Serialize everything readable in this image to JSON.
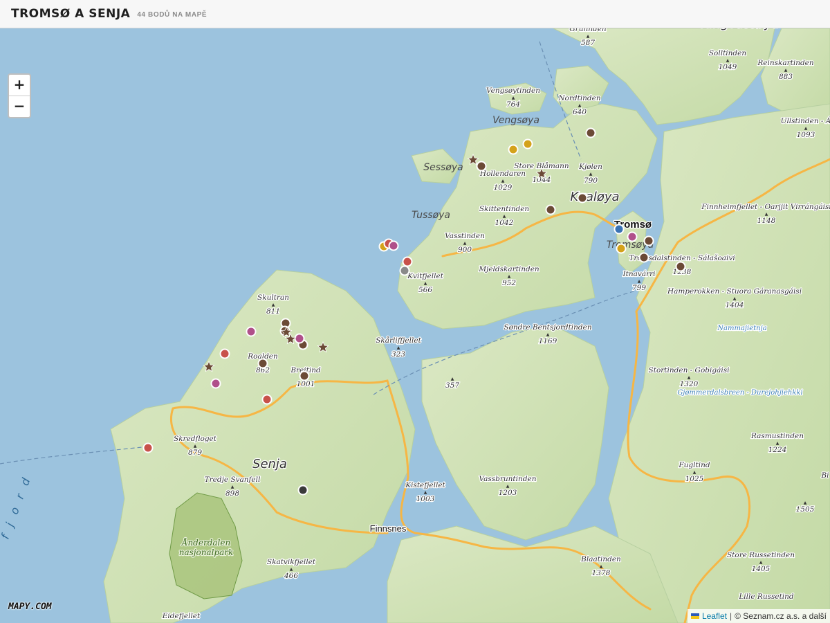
{
  "header": {
    "title": "TROMSØ A SENJA",
    "subtitle": "44 BODŮ NA MAPĚ"
  },
  "zoom": {
    "in": "+",
    "out": "−"
  },
  "logo": "MAPY.COM",
  "attribution": {
    "leaflet": "Leaflet",
    "separator": "|",
    "credits": "© Seznam.cz a.s. a další"
  },
  "colors": {
    "water": "#9cc3de",
    "land": "#cfe1b4",
    "road": "#f6b645",
    "park": "#b7cf8e"
  },
  "places": [
    {
      "name": "Grunnden",
      "elev": "587"
    },
    {
      "name": "Ringvassøya",
      "elev": ""
    },
    {
      "name": "Solltinden",
      "elev": "1049"
    },
    {
      "name": "Reinskartinden",
      "elev": "883"
    },
    {
      "name": "Vengsøytinden",
      "elev": "764"
    },
    {
      "name": "Nordtinden",
      "elev": "640"
    },
    {
      "name": "Vengsøya",
      "elev": ""
    },
    {
      "name": "Ullstinden - Á",
      "elev": "1093"
    },
    {
      "name": "Sessøya",
      "elev": ""
    },
    {
      "name": "Hollendaren",
      "elev": "1029"
    },
    {
      "name": "Store Blåmann",
      "elev": "1044"
    },
    {
      "name": "Kjølen",
      "elev": "790"
    },
    {
      "name": "Kvaløya",
      "elev": ""
    },
    {
      "name": "Tussøya",
      "elev": ""
    },
    {
      "name": "Skittentinden",
      "elev": "1042"
    },
    {
      "name": "Tromsø",
      "elev": ""
    },
    {
      "name": "Tromsøya",
      "elev": ""
    },
    {
      "name": "Finnheimfjellet - Oarjjit Virrángáisi",
      "elev": "1148"
    },
    {
      "name": "Vasstinden",
      "elev": "900"
    },
    {
      "name": "Tromsdalstinden - Sálašoaivi",
      "elev": "1238"
    },
    {
      "name": "Mjeldskartinden",
      "elev": "952"
    },
    {
      "name": "Kvitfjellet",
      "elev": "566"
    },
    {
      "name": "Itnavárri",
      "elev": "799"
    },
    {
      "name": "Hamperokken - Stuora Gáranasgáisi",
      "elev": "1404"
    },
    {
      "name": "Nammajietnja",
      "elev": ""
    },
    {
      "name": "Skultran",
      "elev": "811"
    },
    {
      "name": "Søndre Bentsjordtinden",
      "elev": "1169"
    },
    {
      "name": "Skårliffjellet",
      "elev": "323"
    },
    {
      "name": "Roalden",
      "elev": "862"
    },
    {
      "name": "Breitind",
      "elev": "1001"
    },
    {
      "name": "Stortinden - Gobigáisi",
      "elev": "1320"
    },
    {
      "name": "Gjømmerdalsbreen - Durejohjiehkki",
      "elev": ""
    },
    {
      "name": "",
      "elev": "357"
    },
    {
      "name": "Skredfloget",
      "elev": "879"
    },
    {
      "name": "Senja",
      "elev": ""
    },
    {
      "name": "Rasmustinden",
      "elev": "1224"
    },
    {
      "name": "Tredje Svanfell",
      "elev": "898"
    },
    {
      "name": "Fugltind",
      "elev": "1025"
    },
    {
      "name": "Kistefjellet",
      "elev": "1003"
    },
    {
      "name": "Vassbruntinden",
      "elev": "1203"
    },
    {
      "name": "Ånderdalen nasjonalpark",
      "elev": ""
    },
    {
      "name": "Finnsnes",
      "elev": ""
    },
    {
      "name": "Skatvikfjellet",
      "elev": "466"
    },
    {
      "name": "Blaatinden",
      "elev": "1378"
    },
    {
      "name": "Store Russetinden",
      "elev": "1405"
    },
    {
      "name": "Lille Russetind",
      "elev": ""
    },
    {
      "name": "Eidefjellet",
      "elev": ""
    },
    {
      "name": "",
      "elev": "1505"
    },
    {
      "name": "Bi",
      "elev": ""
    },
    {
      "name": "fjord",
      "elev": ""
    }
  ],
  "markers": [
    {
      "type": "dot",
      "color": "#6b4a36"
    },
    {
      "type": "dot",
      "color": "#6b4a36"
    },
    {
      "type": "dot",
      "color": "#6b4a36"
    },
    {
      "type": "dot",
      "color": "#6b4a36"
    },
    {
      "type": "dot",
      "color": "#6b4a36"
    },
    {
      "type": "dot",
      "color": "#6b4a36"
    },
    {
      "type": "dot",
      "color": "#6b4a36"
    },
    {
      "type": "dot",
      "color": "#6b4a36"
    },
    {
      "type": "dot",
      "color": "#6b4a36"
    },
    {
      "type": "dot",
      "color": "#6b4a36"
    },
    {
      "type": "dot",
      "color": "#6b4a36"
    },
    {
      "type": "dot",
      "color": "#6b4a36"
    },
    {
      "type": "dot",
      "color": "#d4a21a"
    },
    {
      "type": "dot",
      "color": "#d4a21a"
    },
    {
      "type": "dot",
      "color": "#d4a21a"
    },
    {
      "type": "dot",
      "color": "#d4a21a"
    },
    {
      "type": "dot",
      "color": "#c8524a"
    },
    {
      "type": "dot",
      "color": "#c8524a"
    },
    {
      "type": "dot",
      "color": "#c8524a"
    },
    {
      "type": "dot",
      "color": "#c8524a"
    },
    {
      "type": "dot",
      "color": "#c8524a"
    },
    {
      "type": "dot",
      "color": "#b0508a"
    },
    {
      "type": "dot",
      "color": "#b0508a"
    },
    {
      "type": "dot",
      "color": "#b0508a"
    },
    {
      "type": "dot",
      "color": "#b0508a"
    },
    {
      "type": "dot",
      "color": "#b0508a"
    },
    {
      "type": "dot",
      "color": "#8a8a8a"
    },
    {
      "type": "dot",
      "color": "#3a3a3a"
    },
    {
      "type": "dot",
      "color": "#3a73b5"
    },
    {
      "type": "star",
      "color": "#6b4a36"
    },
    {
      "type": "star",
      "color": "#6b4a36"
    },
    {
      "type": "star",
      "color": "#6b4a36"
    },
    {
      "type": "star",
      "color": "#6b4a36"
    },
    {
      "type": "star",
      "color": "#6b4a36"
    },
    {
      "type": "star",
      "color": "#6b4a36"
    }
  ]
}
